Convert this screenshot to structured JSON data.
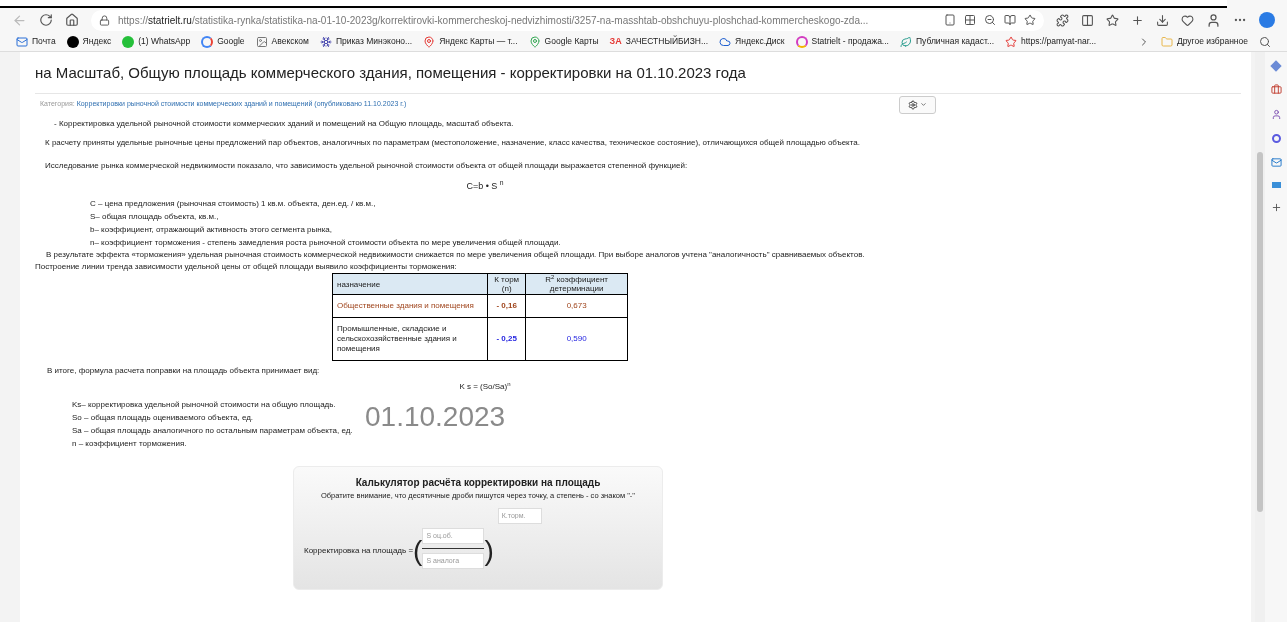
{
  "browser": {
    "url_scheme": "https://",
    "url_host": "statrielt.ru",
    "url_path": "/statistika-rynka/statistika-na-01-10-2023g/korrektirovki-kommercheskoj-nedvizhimosti/3257-na-masshtab-obshchuyu-ploshchad-kommercheskogo-zda...",
    "bookmarks": [
      {
        "kind": "mail",
        "label": "Почта"
      },
      {
        "kind": "yandex",
        "label": "Яндекс"
      },
      {
        "kind": "whatsapp",
        "label": "(1) WhatsApp"
      },
      {
        "kind": "google",
        "label": "Google"
      },
      {
        "kind": "picture",
        "label": "Авекском"
      },
      {
        "kind": "snow",
        "label": "Приказ Минэконо..."
      },
      {
        "kind": "pin",
        "label": "Яндекс Карты — т..."
      },
      {
        "kind": "gpin",
        "label": "Google Карты"
      },
      {
        "kind": "za",
        "label": "ЗАЧЕСТНЫЙБИЗН...",
        "icon_text": "ЗА"
      },
      {
        "kind": "disk",
        "label": "Яндекс.Диск"
      },
      {
        "kind": "swirl",
        "label": "Statrielt - продажа..."
      },
      {
        "kind": "leaf",
        "label": "Публичная кадаст..."
      },
      {
        "kind": "star",
        "label": "https://pamyat-nar..."
      }
    ],
    "other_favorites": "Другое избранное"
  },
  "page": {
    "title": "на Масштаб, Общую площадь коммерческого здания, помещения - корректировки на 01.10.2023 года",
    "category_label": "Категория:",
    "category_link": "Корректировки рыночной стоимости коммерческих зданий и помещений (опубликовано 11.10.2023 г.)",
    "intro": "- Корректировка удельной рыночной стоимости коммерческих зданий и помещений на Общую площадь, масштаб объекта.",
    "basis": "К расчету приняты удельные рыночные цены предложений пар объектов, аналогичных по параметрам (местоположение, назначение, класс качества, техническое состояние), отличающихся общей площадью объекта.",
    "research": "Исследование рынка коммерческой недвижимости показало, что зависимость удельной рыночной стоимости объекта от общей площади выражается степенной функцией:",
    "formula": "C=b • S $^{n}$",
    "definitions": [
      "С – цена предложения (рыночная стоимость) 1 кв.м. объекта, ден.ед. / кв.м.,",
      "S– общая площадь объекта, кв.м.,",
      "b– коэффициент, отражающий активность этого сегмента рынка,",
      "n– коэффициент торможения - степень замедления роста рыночной стоимости объекта по мере увеличения общей площади."
    ],
    "effect": "В результате эффекта «торможения» удельная рыночная стоимость коммерческой недвижимости снижается по мере увеличения общей площади. При выборе аналогов учтена \"аналогичность\" сравниваемых объектов.",
    "trend": "Построение линии тренда зависимости удельной цены от общей площади выявило коэффициенты торможения:",
    "table": {
      "columns": [
        "назначение",
        "К торм (n)",
        "R$^{2}$ коэффициент детерминации"
      ],
      "rows": [
        {
          "name_colored": true,
          "color": "#a0461e",
          "cells": [
            "Общественные здания и помещения",
            "- 0,16",
            "0,673"
          ]
        },
        {
          "name_colored": false,
          "color": "#2525e0",
          "cells": [
            "Промышленные, складские и сельскохозяйственные здания и помещения",
            "- 0,25",
            "0,590"
          ]
        }
      ]
    },
    "conclusion": "В итоге, формула расчета поправки на площадь объекта принимает вид:",
    "formula2": "K s = (So/Sa)$^{n}$",
    "legend": [
      "Ks– корректировка удельной рыночной стоимости на общую площадь.",
      "So – общая площадь оцениваемого объекта, ед.",
      "Sa – общая площадь аналогичного по остальным параметрам объекта, ед.",
      "n – коэффициент торможения."
    ],
    "date_stamp": "01.10.2023",
    "calculator": {
      "title": "Калькулятор расчёта корректировки на площадь",
      "note": "Обратите внимание, что десятичные дроби пишутся через точку, а степень - со знаком \"-\"",
      "label": "Корректировка на площадь =",
      "open_paren": "(",
      "close_paren": ")",
      "numerator_placeholder": "S оц.об.",
      "denominator_placeholder": "S аналога",
      "exponent_placeholder": "К.торм."
    }
  }
}
